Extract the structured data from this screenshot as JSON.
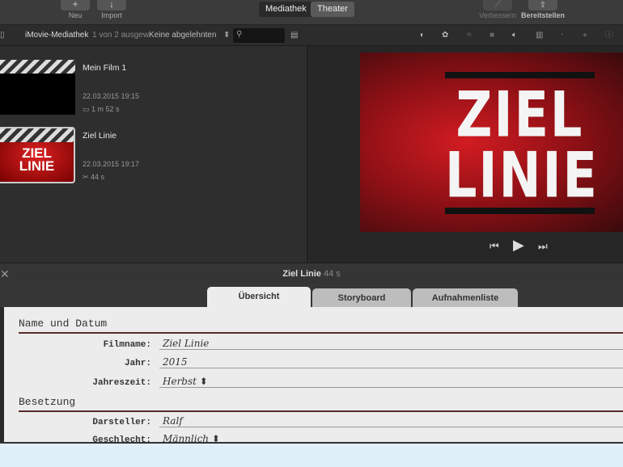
{
  "toolbar": {
    "new_label": "Neu",
    "import_label": "Import",
    "tabs": [
      "Mediathek",
      "Theater"
    ],
    "enhance_label": "Verbessern",
    "share_label": "Bereitstellen"
  },
  "bar2": {
    "library": "iMovie-Mediathek",
    "selection": "1 von 2 ausgew",
    "filter": "Keine abgelehnten",
    "search_placeholder": ""
  },
  "clips": [
    {
      "title": "Mein Film 1",
      "date": "22.03.2015 19:15",
      "duration": "1 m 52 s"
    },
    {
      "title": "Ziel Linie",
      "date": "22.03.2015 19:17",
      "duration": "44 s",
      "thumb_text": [
        "ZIEL",
        "LINIE"
      ]
    }
  ],
  "preview": {
    "lines": [
      "ZIEL",
      "LINIE"
    ]
  },
  "titlebar": {
    "title": "Ziel Linie",
    "duration": "44 s"
  },
  "tabs": [
    "Übersicht",
    "Storyboard",
    "Aufnahmenliste"
  ],
  "form": {
    "section1": "Name und Datum",
    "fields1": [
      {
        "label": "Filmname:",
        "value": "Ziel Linie"
      },
      {
        "label": "Jahr:",
        "value": "2015"
      },
      {
        "label": "Jahreszeit:",
        "value": "Herbst ⬍"
      }
    ],
    "section2": "Besetzung",
    "fields2": [
      {
        "label": "Darsteller:",
        "value": "Ralf"
      },
      {
        "label": "Geschlecht:",
        "value": "Männlich ⬍"
      }
    ]
  }
}
